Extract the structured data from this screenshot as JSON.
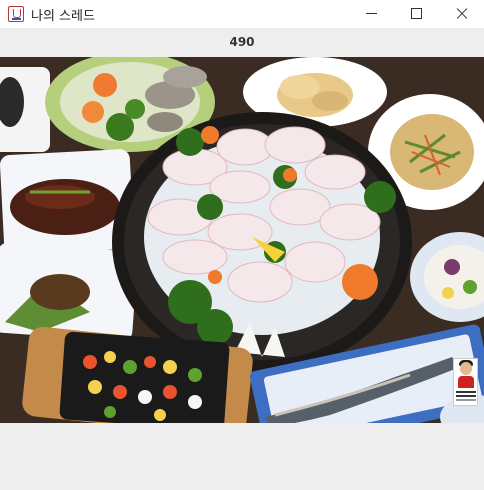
{
  "window": {
    "title": "나의 스레드",
    "controls": {
      "minimize": "minimize",
      "maximize": "maximize",
      "close": "close"
    }
  },
  "counter": {
    "value": "490"
  },
  "photo": {
    "subject": ""
  }
}
